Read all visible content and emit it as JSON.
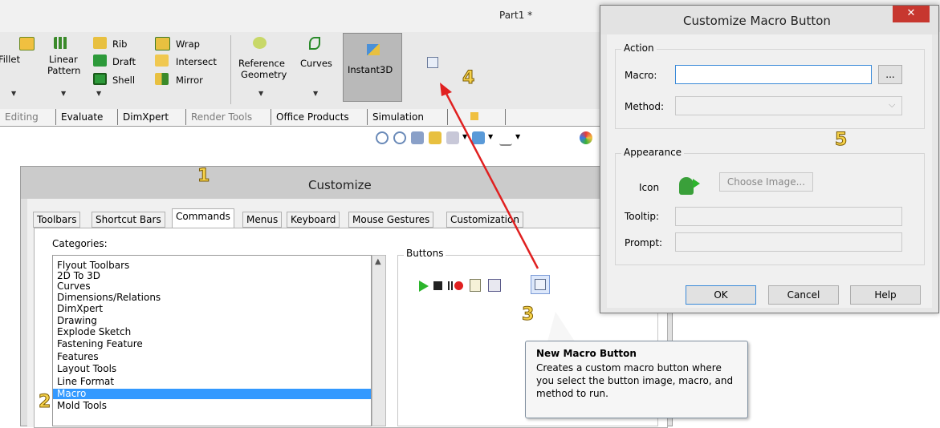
{
  "solidworks": {
    "window_title": "Part1 *",
    "ribbon": {
      "fillet": "Fillet",
      "linear_pattern_1": "Linear",
      "linear_pattern_2": "Pattern",
      "rib": "Rib",
      "draft": "Draft",
      "shell": "Shell",
      "wrap": "Wrap",
      "intersect": "Intersect",
      "mirror": "Mirror",
      "reference_geometry_1": "Reference",
      "reference_geometry_2": "Geometry",
      "curves": "Curves",
      "instant3d": "Instant3D"
    },
    "command_tabs": [
      "Editing",
      "Evaluate",
      "DimXpert",
      "Render Tools",
      "Office Products",
      "Simulation"
    ]
  },
  "customize": {
    "title": "Customize",
    "tabs": [
      "Toolbars",
      "Shortcut Bars",
      "Commands",
      "Menus",
      "Keyboard",
      "Mouse Gestures",
      "Customization"
    ],
    "active_tab": "Commands",
    "categories_label": "Categories:",
    "categories": [
      "Flyout Toolbars",
      "2D To 3D",
      "Curves",
      "Dimensions/Relations",
      "DimXpert",
      "Drawing",
      "Explode Sketch",
      "Fastening Feature",
      "Features",
      "Layout Tools",
      "Line Format",
      "Macro",
      "Mold Tools"
    ],
    "selected_category": "Macro",
    "buttons_label": "Buttons",
    "tooltip": {
      "title": "New Macro Button",
      "body": "Creates a custom macro button where you select the button image, macro, and method to run."
    }
  },
  "macro_button_dialog": {
    "title": "Customize Macro Button",
    "close": "✕",
    "action_label": "Action",
    "macro_label": "Macro:",
    "macro_value": "",
    "browse_button": "...",
    "method_label": "Method:",
    "appearance_label": "Appearance",
    "icon_label": "Icon",
    "choose_image_button": "Choose Image...",
    "tooltip_label": "Tooltip:",
    "prompt_label": "Prompt:",
    "ok_button": "OK",
    "cancel_button": "Cancel",
    "help_button": "Help"
  },
  "callouts": {
    "one": "1",
    "two": "2",
    "three": "3",
    "four": "4",
    "five": "5"
  },
  "colors": {
    "selection": "#3399ff",
    "arrow": "#e02020",
    "callout": "#f6d24a",
    "close": "#c7372f"
  }
}
